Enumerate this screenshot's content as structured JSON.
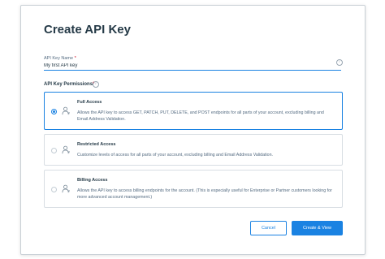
{
  "title": "Create API Key",
  "name_field": {
    "label": "API Key Name",
    "required_mark": "*",
    "value": "My first API key",
    "info_icon": "info-icon"
  },
  "permissions": {
    "heading": "API Key Permissions",
    "required_mark": "*",
    "info_icon": "info-icon",
    "selected": "full",
    "options": [
      {
        "id": "full",
        "icon": "user-icon",
        "title": "Full Access",
        "description": "Allows the API key to access GET, PATCH, PUT, DELETE, and POST endpoints for all parts of your account, excluding billing and Email Address Validation."
      },
      {
        "id": "restricted",
        "icon": "user-icon",
        "title": "Restricted Access",
        "description": "Customize levels of access for all parts of your account, excluding billing and Email Address Validation."
      },
      {
        "id": "billing",
        "icon": "user-icon",
        "title": "Billing Access",
        "description": "Allows the API key to access billing endpoints for the account. (This is especially useful for Enterprise or Partner customers looking for more advanced account management.)"
      }
    ]
  },
  "actions": {
    "cancel_label": "Cancel",
    "create_label": "Create & View"
  },
  "colors": {
    "accent": "#1a82e2",
    "required": "#d0021b",
    "text": "#253a47",
    "muted": "#546b81"
  }
}
